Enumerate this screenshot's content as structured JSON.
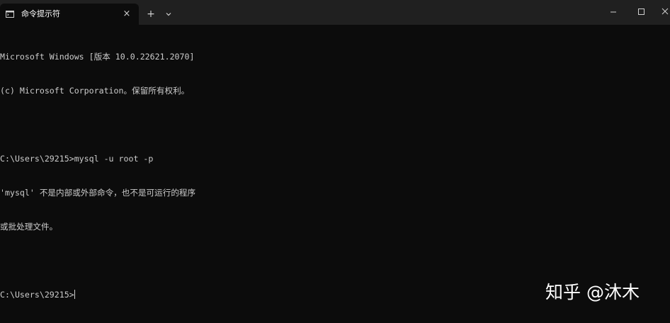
{
  "tab": {
    "title": "命令提示符",
    "icon": "terminal-icon"
  },
  "toolbar": {
    "new_tab_label": "+",
    "close_tab_label": "×"
  },
  "console": {
    "lines": [
      "Microsoft Windows [版本 10.0.22621.2070]",
      "(c) Microsoft Corporation。保留所有权利。",
      "",
      "C:\\Users\\29215>mysql -u root -p",
      "'mysql' 不是内部或外部命令，也不是可运行的程序",
      "或批处理文件。",
      "",
      "C:\\Users\\29215>"
    ]
  },
  "watermark": {
    "text": "知乎 @沐木"
  },
  "colors": {
    "background": "#0c0c0c",
    "titlebar": "#202020",
    "text": "#cccccc"
  }
}
